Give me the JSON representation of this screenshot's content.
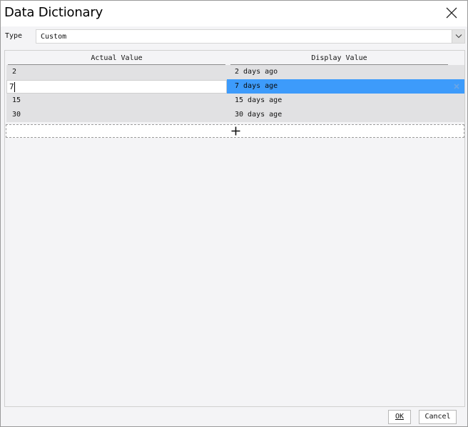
{
  "window": {
    "title": "Data Dictionary"
  },
  "type_field": {
    "label": "Type",
    "value": "Custom"
  },
  "grid": {
    "columns": [
      "Actual Value",
      "Display Value"
    ],
    "rows": [
      {
        "actual": "2",
        "display": "2 days ago"
      },
      {
        "actual": "7",
        "display": "7 days age"
      },
      {
        "actual": "15",
        "display": "15 days age"
      },
      {
        "actual": "30",
        "display": "30 days age"
      }
    ],
    "selected_row": 1
  },
  "buttons": {
    "ok_label": "OK",
    "cancel_label": "Cancel"
  },
  "colors": {
    "selection": "#3d9bfb",
    "row_bg": "#e1e1e3"
  }
}
